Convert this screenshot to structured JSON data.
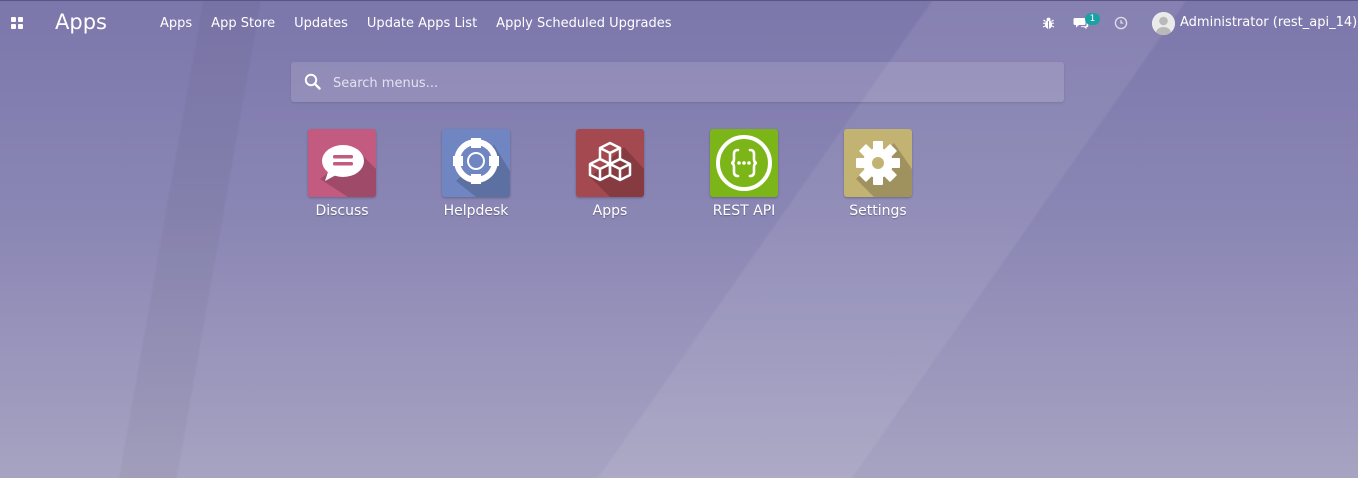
{
  "header": {
    "title": "Apps",
    "menu": [
      "Apps",
      "App Store",
      "Updates",
      "Update Apps List",
      "Apply Scheduled Upgrades"
    ],
    "icons": [
      "apps-grid-icon",
      "bug-icon",
      "chat-icon",
      "clock-icon"
    ],
    "messages_count": "1",
    "user_name": "Administrator (rest_api_14)"
  },
  "search": {
    "placeholder": "Search menus..."
  },
  "apps": [
    {
      "label": "Discuss",
      "icon": "discuss-icon",
      "color": "#c25b7f"
    },
    {
      "label": "Helpdesk",
      "icon": "helpdesk-icon",
      "color": "#6f86c2"
    },
    {
      "label": "Apps",
      "icon": "apps-cubes-icon",
      "color": "#a3494f"
    },
    {
      "label": "REST API",
      "icon": "rest-api-icon",
      "color": "#7cb518"
    },
    {
      "label": "Settings",
      "icon": "settings-gear-icon",
      "color": "#c3b373"
    }
  ],
  "colors": {
    "background": "#8a86b4",
    "badge": "#1aa1a4"
  }
}
